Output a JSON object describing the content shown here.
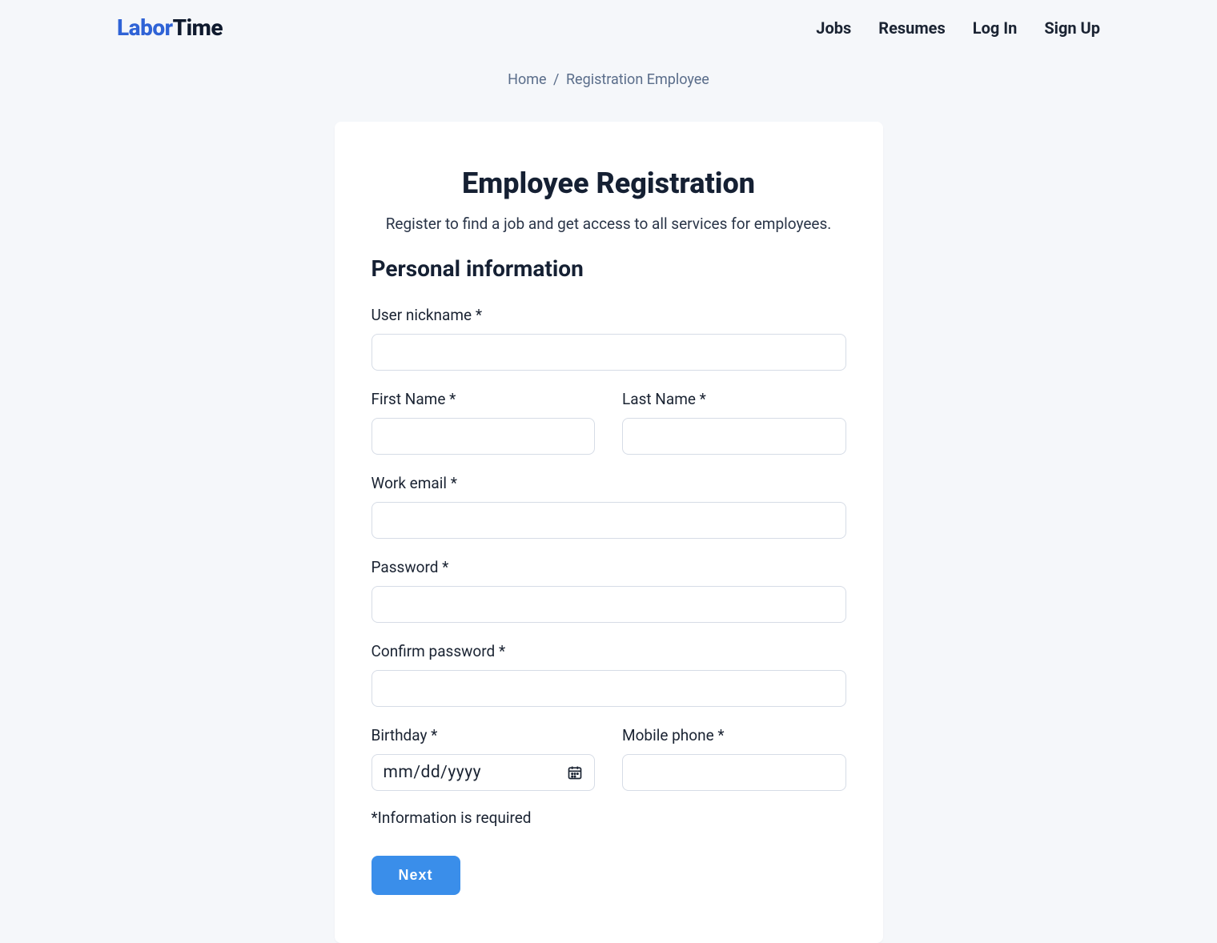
{
  "logo": {
    "first": "Labor",
    "second": "Time"
  },
  "nav": {
    "jobs": "Jobs",
    "resumes": "Resumes",
    "login": "Log In",
    "signup": "Sign Up"
  },
  "breadcrumb": {
    "home": "Home",
    "sep": "/",
    "current": "Registration Employee"
  },
  "card": {
    "title": "Employee Registration",
    "subtitle": "Register to find a job and get access to all services for employees.",
    "section_title": "Personal information",
    "labels": {
      "nickname": "User nickname *",
      "first_name": "First Name *",
      "last_name": "Last Name *",
      "work_email": "Work email *",
      "password": "Password *",
      "confirm_password": "Confirm password *",
      "birthday": "Birthday *",
      "mobile_phone": "Mobile phone *"
    },
    "values": {
      "nickname": "",
      "first_name": "",
      "last_name": "",
      "work_email": "",
      "password": "",
      "confirm_password": "",
      "birthday": "",
      "mobile_phone": ""
    },
    "birthday_placeholder": "mm/dd/yyyy",
    "footnote": "*Information is required",
    "next_label": "Next"
  }
}
